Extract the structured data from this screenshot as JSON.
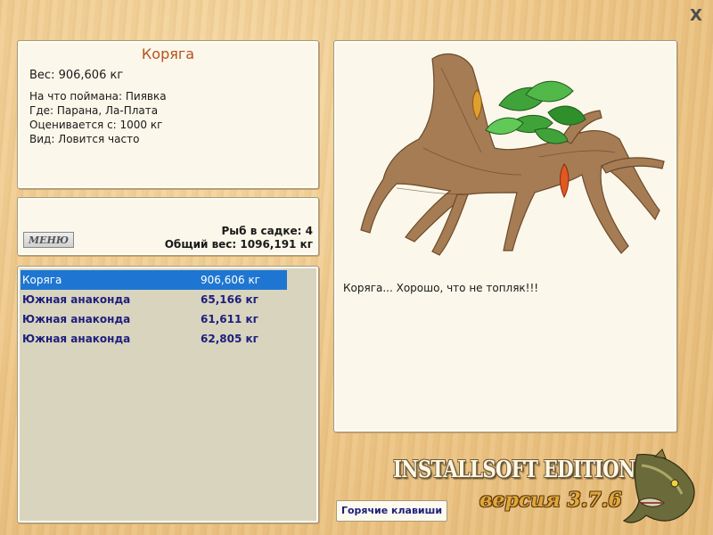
{
  "close_symbol": "X",
  "info": {
    "title": "Коряга",
    "weight": "Вес: 906,606 кг",
    "bait": "На что поймана: Пиявка",
    "location": "Где: Парана, Ла-Плата",
    "valued": "Оценивается с: 1000 кг",
    "kind": "Вид: Ловится часто"
  },
  "summary": {
    "menu_label": "МЕНЮ",
    "fish_count": "Рыб в садке: 4",
    "total_weight": "Общий вес: 1096,191 кг"
  },
  "catch_list": [
    {
      "name": "Коряга",
      "weight": "906,606 кг",
      "selected": true
    },
    {
      "name": "Южная анаконда",
      "weight": "65,166 кг",
      "selected": false
    },
    {
      "name": "Южная анаконда",
      "weight": "61,611 кг",
      "selected": false
    },
    {
      "name": "Южная анаконда",
      "weight": "62,805 кг",
      "selected": false
    }
  ],
  "viewer": {
    "message": "Коряга... Хорошо, что не топляк!!!"
  },
  "footer": {
    "hotkeys_label": "Горячие клавиши",
    "edition": "INSTALLSOFT EDITION",
    "version": "версия 3.7.6"
  },
  "colors": {
    "title": "#b8501a",
    "selection": "#1f76d2",
    "list_text": "#1c1f7d"
  }
}
